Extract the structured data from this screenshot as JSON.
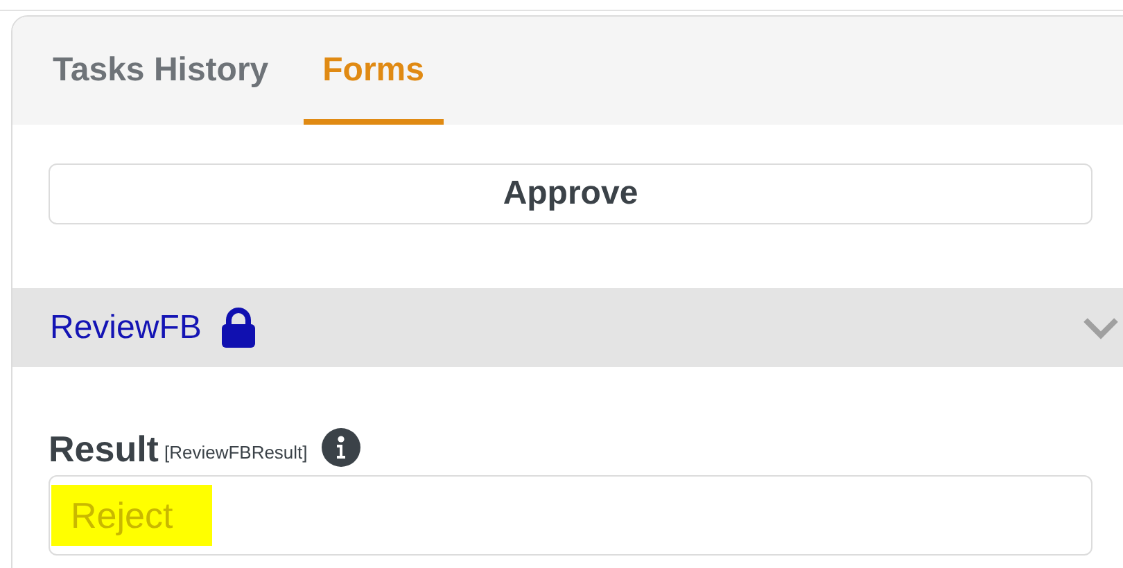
{
  "tabs": [
    {
      "label": "Tasks History",
      "selected": false
    },
    {
      "label": "Forms",
      "selected": true
    }
  ],
  "action_button": "Approve",
  "section": {
    "title": "ReviewFB",
    "locked": true,
    "expanded": true,
    "field": {
      "label": "Result",
      "key": "[ReviewFBResult]",
      "value": "Reject",
      "highlighted": true
    }
  }
}
